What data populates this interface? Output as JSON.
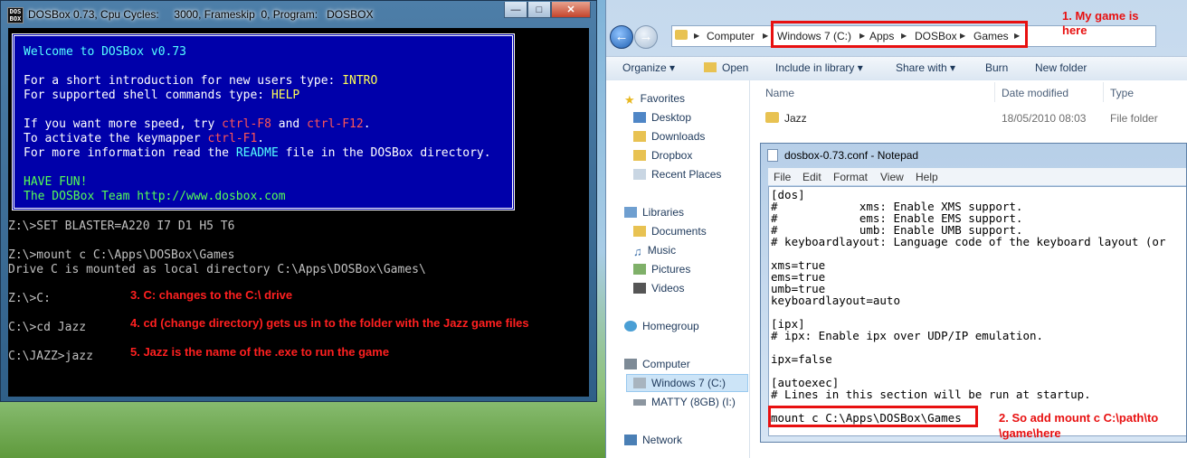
{
  "dosbox": {
    "title": "DOSBox 0.73, Cpu Cycles:     3000, Frameskip  0, Program:   DOSBOX",
    "icon_label": "DOS BOX",
    "caption_buttons": [
      "minimize",
      "maximize",
      "close"
    ],
    "welcome": [
      {
        "text": "Welcome to DOSBox v0.73"
      },
      {
        "text": ""
      },
      {
        "parts": [
          "For a short introduction for new users type: ",
          "INTRO"
        ]
      },
      {
        "parts": [
          "For supported shell commands type: ",
          "HELP"
        ]
      },
      {
        "text": ""
      },
      {
        "parts": [
          "If you want more speed, try ",
          "ctrl-F8",
          " and ",
          "ctrl-F12",
          "."
        ]
      },
      {
        "parts": [
          "To activate the keymapper ",
          "ctrl-F1",
          "."
        ]
      },
      {
        "parts": [
          "For more information read the ",
          "README",
          " file in the DOSBox directory."
        ]
      },
      {
        "text": ""
      },
      {
        "text": "HAVE FUN!"
      },
      {
        "text": "The DOSBox Team http://www.dosbox.com"
      }
    ],
    "console_lines": [
      "Z:\\>SET BLASTER=A220 I7 D1 H5 T6",
      "",
      "Z:\\>mount c C:\\Apps\\DOSBox\\Games",
      "Drive C is mounted as local directory C:\\Apps\\DOSBox\\Games\\",
      "",
      "Z:\\>C:",
      "",
      "C:\\>cd Jazz",
      "",
      "C:\\JAZZ>jazz"
    ],
    "annotations": [
      "3. C: changes to the C:\\ drive",
      "4. cd (change directory) gets us in to the folder with the Jazz game files",
      "5. Jazz is the name of the .exe to run the game"
    ]
  },
  "explorer": {
    "breadcrumb": [
      "Computer",
      "Windows 7 (C:)",
      "Apps",
      "DOSBox",
      "Games"
    ],
    "annotation_1": "1. My game is here",
    "toolbar": [
      "Organize ▾",
      "Open",
      "Include in library ▾",
      "Share with ▾",
      "Burn",
      "New folder"
    ],
    "nav": {
      "favorites": "Favorites",
      "fav_items": [
        "Desktop",
        "Downloads",
        "Dropbox",
        "Recent Places"
      ],
      "libraries": "Libraries",
      "lib_items": [
        "Documents",
        "Music",
        "Pictures",
        "Videos"
      ],
      "homegroup": "Homegroup",
      "computer": "Computer",
      "drives": [
        "Windows 7 (C:)",
        "MATTY (8GB) (I:)"
      ],
      "network": "Network"
    },
    "columns": [
      "Name",
      "Date modified",
      "Type"
    ],
    "files": [
      {
        "name": "Jazz",
        "date": "18/05/2010 08:03",
        "type": "File folder"
      }
    ]
  },
  "notepad": {
    "title": "dosbox-0.73.conf - Notepad",
    "menu": [
      "File",
      "Edit",
      "Format",
      "View",
      "Help"
    ],
    "lines": [
      "[dos]",
      "#            xms: Enable XMS support.",
      "#            ems: Enable EMS support.",
      "#            umb: Enable UMB support.",
      "# keyboardlayout: Language code of the keyboard layout (or",
      "",
      "xms=true",
      "ems=true",
      "umb=true",
      "keyboardlayout=auto",
      "",
      "[ipx]",
      "# ipx: Enable ipx over UDP/IP emulation.",
      "",
      "ipx=false",
      "",
      "[autoexec]",
      "# Lines in this section will be run at startup.",
      "",
      "mount c C:\\Apps\\DOSBox\\Games"
    ],
    "annotation_2": "2. So add mount c C:\\path\\to \\game\\here"
  },
  "colors": {
    "dos_blue": "#0000aa",
    "annotation_red": "#ff2020",
    "highlight_red": "#e81010"
  }
}
